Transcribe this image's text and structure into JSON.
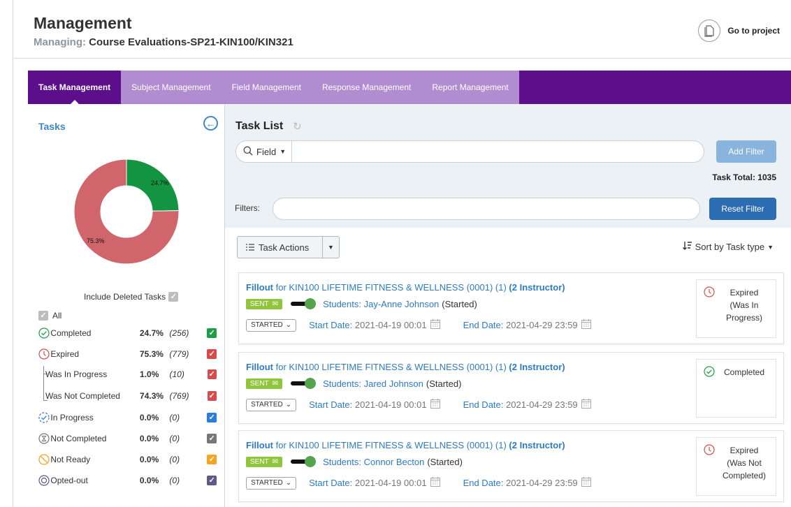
{
  "header": {
    "title": "Management",
    "managing_label": "Managing:",
    "managing_value": "Course Evaluations-SP21-KIN100/KIN321",
    "go_to_project": "Go to project"
  },
  "tabs": [
    {
      "label": "Task Management",
      "active": true
    },
    {
      "label": "Subject Management"
    },
    {
      "label": "Field Management"
    },
    {
      "label": "Response Management"
    },
    {
      "label": "Report Management"
    }
  ],
  "sidebar": {
    "title": "Tasks",
    "include_deleted": "Include Deleted Tasks",
    "all_label": "All",
    "donut": {
      "completed_pct": 24.7,
      "expired_pct": 75.3,
      "completed_label": "24.7%",
      "expired_label": "75.3%",
      "completed_color": "#139440",
      "expired_color": "#d0666b"
    },
    "stats": [
      {
        "label": "Completed",
        "pct": "24.7%",
        "count": "(256)",
        "icon": "check-circle-icon",
        "color": "#1e9d48"
      },
      {
        "label": "Expired",
        "pct": "75.3%",
        "count": "(779)",
        "icon": "clock-icon",
        "color": "#d74b4b"
      },
      {
        "label": "Was In Progress",
        "pct": "1.0%",
        "count": "(10)",
        "color": "#d74b4b"
      },
      {
        "label": "Was Not Completed",
        "pct": "74.3%",
        "count": "(769)",
        "color": "#d74b4b"
      },
      {
        "label": "In Progress",
        "pct": "0.0%",
        "count": "(0)",
        "icon": "progress-circle-icon",
        "color": "#2e7bd8"
      },
      {
        "label": "Not Completed",
        "pct": "0.0%",
        "count": "(0)",
        "icon": "hourglass-icon",
        "color": "#777777"
      },
      {
        "label": "Not Ready",
        "pct": "0.0%",
        "count": "(0)",
        "icon": "not-ready-icon",
        "color": "#f5a524"
      },
      {
        "label": "Opted-out",
        "pct": "0.0%",
        "count": "(0)",
        "icon": "opted-out-icon",
        "color": "#5b5b84"
      }
    ]
  },
  "main": {
    "title": "Task List",
    "search_field": "Field",
    "search_value": "",
    "add_filter": "Add Filter",
    "task_total_label": "Task Total:",
    "task_total_value": "1035",
    "filters_label": "Filters:",
    "filters_value": "",
    "reset_filter": "Reset Filter",
    "task_actions": "Task Actions",
    "sort_label": "Sort by Task type"
  },
  "tasks": [
    {
      "fillout": "Fillout",
      "for": "for KIN100 LIFETIME FITNESS & WELLNESS (0001) (1)",
      "role": "(2 Instructor)",
      "sent": "SENT",
      "student_label": "Students: Jay-Anne Johnson",
      "student_status": "(Started)",
      "state": "STARTED",
      "start_label": "Start Date:",
      "start_date": "2021-04-19 00:01",
      "end_label": "End Date:",
      "end_date": "2021-04-29 23:59",
      "status_icon": "clock-icon",
      "status_line1": "Expired",
      "status_line2": "(Was In",
      "status_line3": "Progress)"
    },
    {
      "fillout": "Fillout",
      "for": "for KIN100 LIFETIME FITNESS & WELLNESS (0001) (1)",
      "role": "(2 Instructor)",
      "sent": "SENT",
      "student_label": "Students: Jared Johnson",
      "student_status": "(Started)",
      "state": "STARTED",
      "start_label": "Start Date:",
      "start_date": "2021-04-19 00:01",
      "end_label": "End Date:",
      "end_date": "2021-04-29 23:59",
      "status_icon": "check-circle-icon",
      "status_line1": "Completed",
      "status_line2": "",
      "status_line3": ""
    },
    {
      "fillout": "Fillout",
      "for": "for KIN100 LIFETIME FITNESS & WELLNESS (0001) (1)",
      "role": "(2 Instructor)",
      "sent": "SENT",
      "student_label": "Students: Connor Becton",
      "student_status": "(Started)",
      "state": "STARTED",
      "start_label": "Start Date:",
      "start_date": "2021-04-19 00:01",
      "end_label": "End Date:",
      "end_date": "2021-04-29 23:59",
      "status_icon": "clock-icon",
      "status_line1": "Expired",
      "status_line2": "(Was Not",
      "status_line3": "Completed)"
    }
  ]
}
